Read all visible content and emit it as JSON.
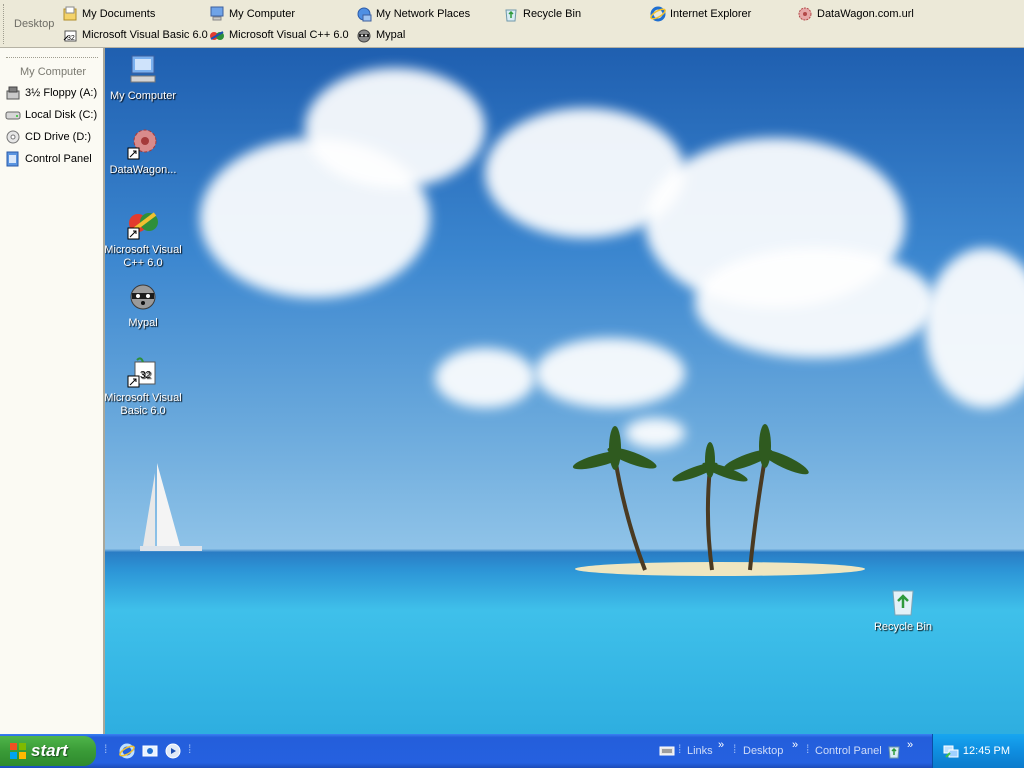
{
  "top_toolbar": {
    "label": "Desktop",
    "items": [
      {
        "label": "My Documents",
        "icon": "my-documents-icon"
      },
      {
        "label": "My Computer",
        "icon": "my-computer-icon"
      },
      {
        "label": "My Network Places",
        "icon": "network-places-icon"
      },
      {
        "label": "Recycle Bin",
        "icon": "recycle-bin-icon"
      },
      {
        "label": "Internet Explorer",
        "icon": "internet-explorer-icon"
      },
      {
        "label": "DataWagon.com.url",
        "icon": "datawagon-url-icon"
      },
      {
        "label": "Microsoft Visual Basic 6.0",
        "icon": "visual-basic-icon"
      },
      {
        "label": "Microsoft Visual C++ 6.0",
        "icon": "visual-cpp-icon"
      },
      {
        "label": "Mypal",
        "icon": "mypal-icon"
      }
    ]
  },
  "left_toolbar": {
    "label": "My Computer",
    "items": [
      {
        "label": "3½ Floppy (A:)",
        "icon": "floppy-drive-icon"
      },
      {
        "label": "Local Disk (C:)",
        "icon": "local-disk-icon"
      },
      {
        "label": "CD Drive (D:)",
        "icon": "cd-drive-icon"
      },
      {
        "label": "Control Panel",
        "icon": "control-panel-icon"
      }
    ]
  },
  "desktop_icons": [
    {
      "label": "My Computer"
    },
    {
      "label": "DataWagon..."
    },
    {
      "label": "Microsoft Visual C++ 6.0"
    },
    {
      "label": "Mypal"
    },
    {
      "label": "Microsoft Visual Basic 6.0"
    },
    {
      "label": "Recycle Bin"
    }
  ],
  "taskbar": {
    "start_label": "start",
    "toolbars": {
      "links": "Links",
      "desktop": "Desktop",
      "control_panel": "Control Panel"
    },
    "clock": "12:45 PM"
  },
  "colors": {
    "taskbar_blue": "#245edb",
    "start_green": "#3a9b37",
    "tray_blue": "#0f8ee0",
    "toolbar_bg": "#ece9d8"
  }
}
